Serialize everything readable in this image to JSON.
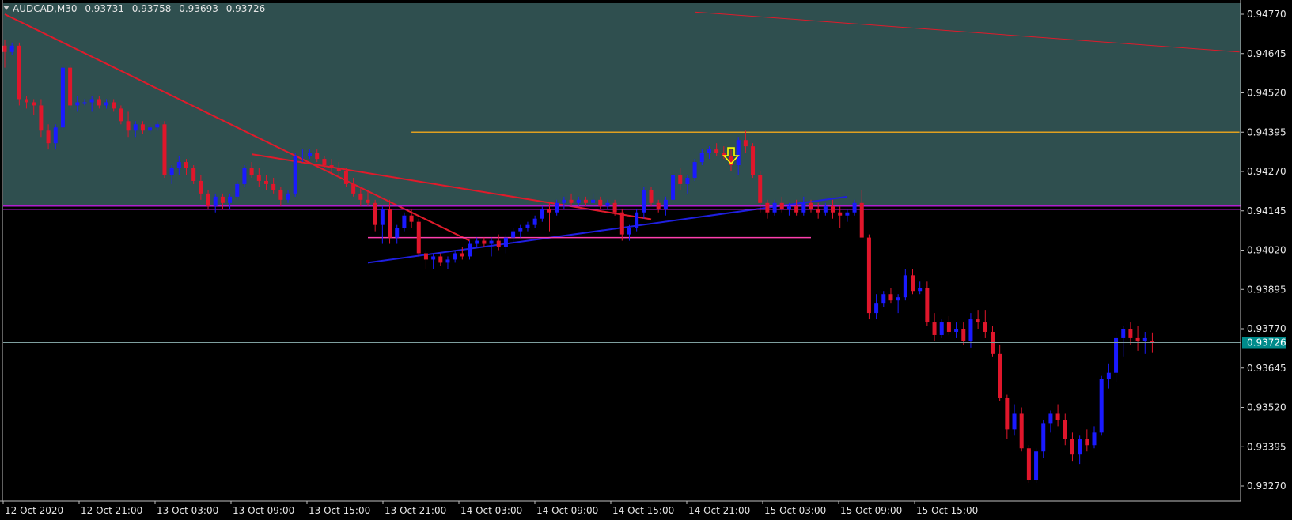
{
  "header": {
    "symbol_timeframe": "AUDCAD,M30",
    "open": "0.93731",
    "high": "0.93758",
    "low": "0.93693",
    "close": "0.93726"
  },
  "colors": {
    "background": "#000000",
    "zone_fill": "#2f4f4f",
    "bull_candle": "#1a1aff",
    "bear_candle": "#e0162b",
    "axis": "#c0c0c0",
    "trendline_red": "#e01b2b",
    "trendline_blue": "#1f1fe0",
    "resistance_orange": "#e0a020",
    "support_magenta": "#ff3fae",
    "level_purple": "#b020d0",
    "arrow_yellow": "#ffff00",
    "current_price_line": "#7f9f9f",
    "price_tag": "#008b8b"
  },
  "chart_data": {
    "type": "candlestick",
    "instrument": "AUDCAD",
    "timeframe": "M30",
    "current_price": 0.93726,
    "y_ticks": [
      "0.94770",
      "0.94645",
      "0.94520",
      "0.94395",
      "0.94270",
      "0.94145",
      "0.94020",
      "0.93895",
      "0.93770",
      "0.93645",
      "0.93520",
      "0.93395",
      "0.93270"
    ],
    "x_ticks": [
      "12 Oct 2020",
      "12 Oct 21:00",
      "13 Oct 03:00",
      "13 Oct 09:00",
      "13 Oct 15:00",
      "13 Oct 21:00",
      "14 Oct 03:00",
      "14 Oct 09:00",
      "14 Oct 15:00",
      "14 Oct 21:00",
      "15 Oct 03:00",
      "15 Oct 09:00",
      "15 Oct 15:00"
    ],
    "candles": [
      [
        0.9467,
        0.9469,
        0.946,
        0.9465
      ],
      [
        0.9465,
        0.9468,
        0.9464,
        0.9467
      ],
      [
        0.9467,
        0.9468,
        0.9448,
        0.945
      ],
      [
        0.945,
        0.9451,
        0.9447,
        0.9449
      ],
      [
        0.9449,
        0.945,
        0.9445,
        0.9448
      ],
      [
        0.9448,
        0.945,
        0.9438,
        0.944
      ],
      [
        0.944,
        0.9442,
        0.9434,
        0.9436
      ],
      [
        0.9436,
        0.9442,
        0.9434,
        0.9441
      ],
      [
        0.9441,
        0.9461,
        0.944,
        0.946
      ],
      [
        0.946,
        0.9461,
        0.9447,
        0.9448
      ],
      [
        0.9448,
        0.9451,
        0.9446,
        0.9449
      ],
      [
        0.9449,
        0.945,
        0.9448,
        0.9449
      ],
      [
        0.9449,
        0.9451,
        0.9446,
        0.945
      ],
      [
        0.945,
        0.9451,
        0.9447,
        0.9448
      ],
      [
        0.9448,
        0.945,
        0.9447,
        0.9449
      ],
      [
        0.9449,
        0.945,
        0.9446,
        0.9447
      ],
      [
        0.9447,
        0.9448,
        0.9442,
        0.9443
      ],
      [
        0.9443,
        0.9446,
        0.9438,
        0.944
      ],
      [
        0.944,
        0.9443,
        0.9438,
        0.9442
      ],
      [
        0.9442,
        0.9443,
        0.9439,
        0.944
      ],
      [
        0.944,
        0.9442,
        0.9439,
        0.9441
      ],
      [
        0.9441,
        0.9443,
        0.944,
        0.9442
      ],
      [
        0.9442,
        0.9443,
        0.9425,
        0.9426
      ],
      [
        0.9426,
        0.9429,
        0.9423,
        0.9428
      ],
      [
        0.9428,
        0.9432,
        0.9426,
        0.943
      ],
      [
        0.943,
        0.9431,
        0.9426,
        0.9428
      ],
      [
        0.9428,
        0.9429,
        0.9423,
        0.9424
      ],
      [
        0.9424,
        0.9426,
        0.9418,
        0.942
      ],
      [
        0.942,
        0.9421,
        0.9415,
        0.9416
      ],
      [
        0.9416,
        0.942,
        0.9414,
        0.9419
      ],
      [
        0.9419,
        0.942,
        0.9415,
        0.9417
      ],
      [
        0.9417,
        0.942,
        0.9415,
        0.9419
      ],
      [
        0.9419,
        0.9424,
        0.9418,
        0.9423
      ],
      [
        0.9423,
        0.9429,
        0.9422,
        0.9428
      ],
      [
        0.9428,
        0.943,
        0.9425,
        0.9426
      ],
      [
        0.9426,
        0.9428,
        0.9422,
        0.9424
      ],
      [
        0.9424,
        0.9426,
        0.9421,
        0.9423
      ],
      [
        0.9423,
        0.9425,
        0.942,
        0.9421
      ],
      [
        0.9421,
        0.9422,
        0.9416,
        0.9418
      ],
      [
        0.9418,
        0.9421,
        0.9417,
        0.942
      ],
      [
        0.942,
        0.9433,
        0.9419,
        0.9432
      ],
      [
        0.9432,
        0.9434,
        0.943,
        0.9432
      ],
      [
        0.9432,
        0.9434,
        0.9431,
        0.9433
      ],
      [
        0.9433,
        0.9434,
        0.943,
        0.9431
      ],
      [
        0.9431,
        0.9432,
        0.9428,
        0.9429
      ],
      [
        0.9429,
        0.9431,
        0.9426,
        0.9428
      ],
      [
        0.9428,
        0.943,
        0.9426,
        0.9427
      ],
      [
        0.9427,
        0.9428,
        0.9422,
        0.9423
      ],
      [
        0.9423,
        0.9425,
        0.9419,
        0.942
      ],
      [
        0.942,
        0.9422,
        0.9416,
        0.9418
      ],
      [
        0.9418,
        0.9421,
        0.9416,
        0.9417
      ],
      [
        0.9417,
        0.9418,
        0.9408,
        0.941
      ],
      [
        0.941,
        0.9416,
        0.9404,
        0.9415
      ],
      [
        0.9415,
        0.9418,
        0.9404,
        0.9406
      ],
      [
        0.9406,
        0.941,
        0.9404,
        0.9409
      ],
      [
        0.9409,
        0.9414,
        0.9408,
        0.9413
      ],
      [
        0.9413,
        0.9415,
        0.9409,
        0.9411
      ],
      [
        0.9411,
        0.9412,
        0.94,
        0.9401
      ],
      [
        0.9401,
        0.9402,
        0.9396,
        0.9399
      ],
      [
        0.9399,
        0.9401,
        0.9396,
        0.94
      ],
      [
        0.94,
        0.9401,
        0.9397,
        0.9398
      ],
      [
        0.9398,
        0.94,
        0.9396,
        0.9399
      ],
      [
        0.9399,
        0.9402,
        0.9398,
        0.9401
      ],
      [
        0.9401,
        0.9403,
        0.9399,
        0.94
      ],
      [
        0.94,
        0.9405,
        0.9399,
        0.9404
      ],
      [
        0.9404,
        0.9406,
        0.9403,
        0.9405
      ],
      [
        0.9405,
        0.9406,
        0.9403,
        0.9404
      ],
      [
        0.9404,
        0.9406,
        0.94,
        0.9405
      ],
      [
        0.9405,
        0.9407,
        0.9402,
        0.9403
      ],
      [
        0.9403,
        0.9407,
        0.9401,
        0.9406
      ],
      [
        0.9406,
        0.9409,
        0.9404,
        0.9408
      ],
      [
        0.9408,
        0.941,
        0.9406,
        0.9409
      ],
      [
        0.9409,
        0.9411,
        0.9408,
        0.941
      ],
      [
        0.941,
        0.9413,
        0.9409,
        0.9412
      ],
      [
        0.9412,
        0.9416,
        0.9411,
        0.9415
      ],
      [
        0.9415,
        0.9417,
        0.9408,
        0.9414
      ],
      [
        0.9414,
        0.9418,
        0.9413,
        0.9417
      ],
      [
        0.9417,
        0.9419,
        0.9415,
        0.9418
      ],
      [
        0.9418,
        0.942,
        0.9416,
        0.9417
      ],
      [
        0.9417,
        0.9419,
        0.9416,
        0.9418
      ],
      [
        0.9418,
        0.9419,
        0.9416,
        0.9417
      ],
      [
        0.9417,
        0.942,
        0.9416,
        0.9418
      ],
      [
        0.9418,
        0.9419,
        0.9415,
        0.9416
      ],
      [
        0.9416,
        0.9418,
        0.9415,
        0.9417
      ],
      [
        0.9417,
        0.9418,
        0.9413,
        0.9414
      ],
      [
        0.9414,
        0.9415,
        0.9405,
        0.9407
      ],
      [
        0.9407,
        0.941,
        0.9405,
        0.9409
      ],
      [
        0.9409,
        0.9415,
        0.9408,
        0.9414
      ],
      [
        0.9414,
        0.9422,
        0.9412,
        0.9421
      ],
      [
        0.9421,
        0.9422,
        0.9416,
        0.9417
      ],
      [
        0.9417,
        0.9418,
        0.9414,
        0.9415
      ],
      [
        0.9415,
        0.9419,
        0.9413,
        0.9418
      ],
      [
        0.9418,
        0.9427,
        0.9417,
        0.9426
      ],
      [
        0.9426,
        0.9428,
        0.9421,
        0.9423
      ],
      [
        0.9423,
        0.9426,
        0.942,
        0.9425
      ],
      [
        0.9425,
        0.9431,
        0.9424,
        0.943
      ],
      [
        0.943,
        0.9434,
        0.9429,
        0.9433
      ],
      [
        0.9433,
        0.9435,
        0.9431,
        0.9434
      ],
      [
        0.9434,
        0.9436,
        0.9432,
        0.9433
      ],
      [
        0.9433,
        0.9435,
        0.9431,
        0.9432
      ],
      [
        0.9432,
        0.9434,
        0.9427,
        0.9429
      ],
      [
        0.9429,
        0.9438,
        0.9426,
        0.9437
      ],
      [
        0.9437,
        0.944,
        0.9433,
        0.9435
      ],
      [
        0.9435,
        0.9436,
        0.9425,
        0.9426
      ],
      [
        0.9426,
        0.9427,
        0.9414,
        0.9417
      ],
      [
        0.9417,
        0.9418,
        0.9412,
        0.9414
      ],
      [
        0.9414,
        0.9418,
        0.9413,
        0.9417
      ],
      [
        0.9417,
        0.9419,
        0.9414,
        0.9415
      ],
      [
        0.9415,
        0.9417,
        0.9413,
        0.9416
      ],
      [
        0.9416,
        0.9418,
        0.9413,
        0.9414
      ],
      [
        0.9414,
        0.9419,
        0.9413,
        0.9417
      ],
      [
        0.9417,
        0.9418,
        0.9414,
        0.9415
      ],
      [
        0.9415,
        0.9417,
        0.9412,
        0.9414
      ],
      [
        0.9414,
        0.9417,
        0.9413,
        0.9416
      ],
      [
        0.9416,
        0.9418,
        0.9412,
        0.9414
      ],
      [
        0.9414,
        0.9416,
        0.9409,
        0.9413
      ],
      [
        0.9413,
        0.9415,
        0.9411,
        0.9414
      ],
      [
        0.9414,
        0.9418,
        0.9413,
        0.9417
      ],
      [
        0.9417,
        0.9421,
        0.9414,
        0.9406
      ],
      [
        0.9406,
        0.9407,
        0.938,
        0.9382
      ],
      [
        0.9382,
        0.9388,
        0.938,
        0.9385
      ],
      [
        0.9385,
        0.9389,
        0.9384,
        0.9388
      ],
      [
        0.9388,
        0.939,
        0.9385,
        0.9386
      ],
      [
        0.9386,
        0.9388,
        0.9382,
        0.9387
      ],
      [
        0.9387,
        0.9396,
        0.9386,
        0.9394
      ],
      [
        0.9394,
        0.9396,
        0.9388,
        0.9389
      ],
      [
        0.9389,
        0.9392,
        0.9388,
        0.939
      ],
      [
        0.939,
        0.9392,
        0.9378,
        0.9379
      ],
      [
        0.9379,
        0.9382,
        0.9373,
        0.9375
      ],
      [
        0.9375,
        0.938,
        0.9374,
        0.9379
      ],
      [
        0.9379,
        0.9381,
        0.9375,
        0.9376
      ],
      [
        0.9376,
        0.9379,
        0.9374,
        0.9377
      ],
      [
        0.9377,
        0.9379,
        0.9372,
        0.9373
      ],
      [
        0.9373,
        0.9382,
        0.9371,
        0.938
      ],
      [
        0.938,
        0.9383,
        0.9377,
        0.9379
      ],
      [
        0.9379,
        0.9383,
        0.9374,
        0.9376
      ],
      [
        0.9376,
        0.9378,
        0.9368,
        0.9369
      ],
      [
        0.9369,
        0.9372,
        0.9354,
        0.9355
      ],
      [
        0.9355,
        0.9356,
        0.9342,
        0.9345
      ],
      [
        0.9345,
        0.9353,
        0.9343,
        0.935
      ],
      [
        0.935,
        0.9352,
        0.9338,
        0.9339
      ],
      [
        0.9339,
        0.934,
        0.9328,
        0.9329
      ],
      [
        0.9329,
        0.9339,
        0.9328,
        0.9338
      ],
      [
        0.9338,
        0.9348,
        0.9336,
        0.9347
      ],
      [
        0.9347,
        0.9351,
        0.9344,
        0.935
      ],
      [
        0.935,
        0.9353,
        0.9346,
        0.9348
      ],
      [
        0.9348,
        0.935,
        0.934,
        0.9342
      ],
      [
        0.9342,
        0.9344,
        0.9335,
        0.9337
      ],
      [
        0.9337,
        0.9343,
        0.9334,
        0.9342
      ],
      [
        0.9342,
        0.9345,
        0.9338,
        0.934
      ],
      [
        0.934,
        0.9346,
        0.9339,
        0.9344
      ],
      [
        0.9344,
        0.9362,
        0.9343,
        0.9361
      ],
      [
        0.9361,
        0.9366,
        0.9358,
        0.9363
      ],
      [
        0.9363,
        0.9376,
        0.936,
        0.9374
      ],
      [
        0.9374,
        0.9378,
        0.9368,
        0.9377
      ],
      [
        0.9377,
        0.9379,
        0.9372,
        0.9374
      ],
      [
        0.9374,
        0.9378,
        0.937,
        0.9373
      ],
      [
        0.9373,
        0.9376,
        0.9369,
        0.9374
      ],
      [
        0.93731,
        0.93758,
        0.93693,
        0.93726
      ]
    ],
    "lines": [
      {
        "type": "trendline",
        "color": "red",
        "from": {
          "candle": 0,
          "price": 0.9477
        },
        "to": {
          "candle": 64,
          "price": 0.9405
        }
      },
      {
        "type": "trendline",
        "color": "red",
        "from": {
          "candle": 34,
          "price": 0.94325
        },
        "to": {
          "candle": 89,
          "price": 0.94118
        }
      },
      {
        "type": "trendline",
        "color": "red",
        "from": {
          "candle": 95,
          "price": 0.94777
        },
        "to": {
          "candle": 170,
          "price": 0.9465
        }
      },
      {
        "type": "trendline",
        "color": "blue",
        "from": {
          "candle": 50,
          "price": 0.9398
        },
        "to": {
          "candle": 116,
          "price": 0.9419
        }
      },
      {
        "type": "horizontal",
        "color": "orange",
        "price": 0.94395,
        "from_candle": 56,
        "to_candle": 170
      },
      {
        "type": "horizontal",
        "color": "magenta",
        "price": 0.9406,
        "from_candle": 50,
        "to_candle": 111
      },
      {
        "type": "horizontal",
        "color": "purple",
        "price": 0.9416,
        "full_width": true
      },
      {
        "type": "horizontal",
        "color": "purple",
        "price": 0.9415,
        "full_width": true
      }
    ],
    "zone": {
      "from_price": 0.9416,
      "to_price": 0.9483
    },
    "arrow": {
      "candle": 100,
      "price": 0.9429,
      "direction": "down"
    }
  }
}
